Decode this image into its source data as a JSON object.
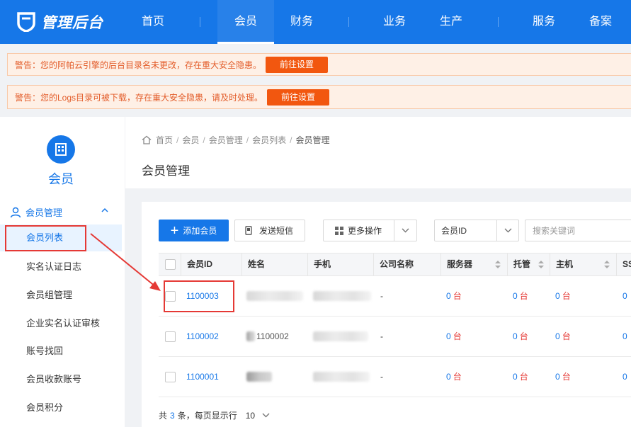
{
  "header": {
    "logo_text": "管理后台",
    "nav": [
      "首页",
      "会员",
      "财务",
      "业务",
      "生产",
      "服务",
      "备案"
    ],
    "active_nav": "会员"
  },
  "warnings": [
    {
      "text": "警告：您的阿帕云引擎的后台目录名未更改，存在重大安全隐患。",
      "button": "前往设置"
    },
    {
      "text": "警告：您的Logs目录可被下载，存在重大安全隐患，请及时处理。",
      "button": "前往设置"
    }
  ],
  "sidebar": {
    "module_icon": "building-icon",
    "module_label": "会员",
    "group_label": "会员管理",
    "items": [
      "会员列表",
      "实名认证日志",
      "会员组管理",
      "企业实名认证审核",
      "账号找回",
      "会员收款账号",
      "会员积分"
    ],
    "active_item": "会员列表"
  },
  "breadcrumb": [
    "首页",
    "会员",
    "会员管理",
    "会员列表",
    "会员管理"
  ],
  "page_title": "会员管理",
  "toolbar": {
    "add_label": "添加会员",
    "sms_label": "发送短信",
    "more_label": "更多操作",
    "select_value": "会员ID",
    "search_placeholder": "搜索关键词"
  },
  "table": {
    "columns": [
      "会员ID",
      "姓名",
      "手机",
      "公司名称",
      "服务器",
      "托管",
      "主机",
      "SS"
    ],
    "rows": [
      {
        "id": "1100003",
        "name": "",
        "phone": "",
        "company": "-",
        "server": "0",
        "hosting": "0",
        "host": "0",
        "ss": "0"
      },
      {
        "id": "1100002",
        "name": "1100002",
        "phone": "",
        "company": "-",
        "server": "0",
        "hosting": "0",
        "host": "0",
        "ss": "0"
      },
      {
        "id": "1100001",
        "name": "",
        "phone": "",
        "company": "-",
        "server": "0",
        "hosting": "0",
        "host": "0",
        "ss": "0"
      }
    ],
    "unit": "台"
  },
  "pagination": {
    "total_prefix": "共",
    "total": "3",
    "total_suffix": "条，每页显示行",
    "page_size": "10"
  },
  "colors": {
    "primary": "#1677e8",
    "warning_text": "#e35d2b",
    "warning_button": "#f2570f",
    "highlight": "#e53935"
  }
}
